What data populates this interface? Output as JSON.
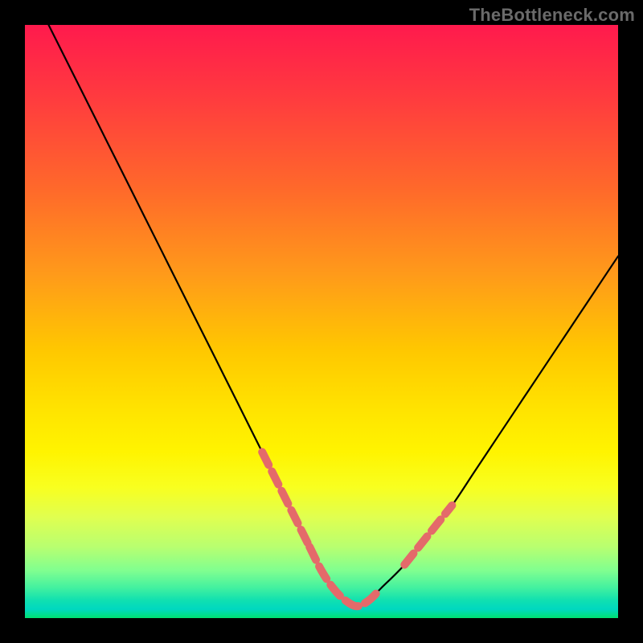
{
  "watermark": "TheBottleneck.com",
  "colors": {
    "background": "#000000",
    "curve": "#000000",
    "highlight": "#e46a6a",
    "gradient_top": "#ff1a4d",
    "gradient_bottom": "#00e070"
  },
  "chart_data": {
    "type": "line",
    "title": "",
    "xlabel": "",
    "ylabel": "",
    "xlim": [
      0,
      100
    ],
    "ylim": [
      0,
      100
    ],
    "series": [
      {
        "name": "bottleneck-curve",
        "x": [
          4,
          8,
          12,
          16,
          20,
          24,
          28,
          32,
          36,
          40,
          44,
          48,
          50,
          52,
          54,
          56,
          58,
          60,
          64,
          68,
          72,
          76,
          80,
          84,
          88,
          92,
          96,
          100
        ],
        "y": [
          100,
          92,
          84,
          76,
          68,
          60,
          52,
          44,
          36,
          28,
          20,
          12,
          8,
          5,
          3,
          2,
          3,
          5,
          9,
          14,
          19,
          25,
          31,
          37,
          43,
          49,
          55,
          61
        ]
      }
    ],
    "highlight_ranges": [
      {
        "name": "left-descent",
        "x_start": 38,
        "x_end": 48
      },
      {
        "name": "valley-floor",
        "x_start": 48,
        "x_end": 62
      },
      {
        "name": "right-ascent",
        "x_start": 62,
        "x_end": 72
      }
    ],
    "annotations": []
  }
}
